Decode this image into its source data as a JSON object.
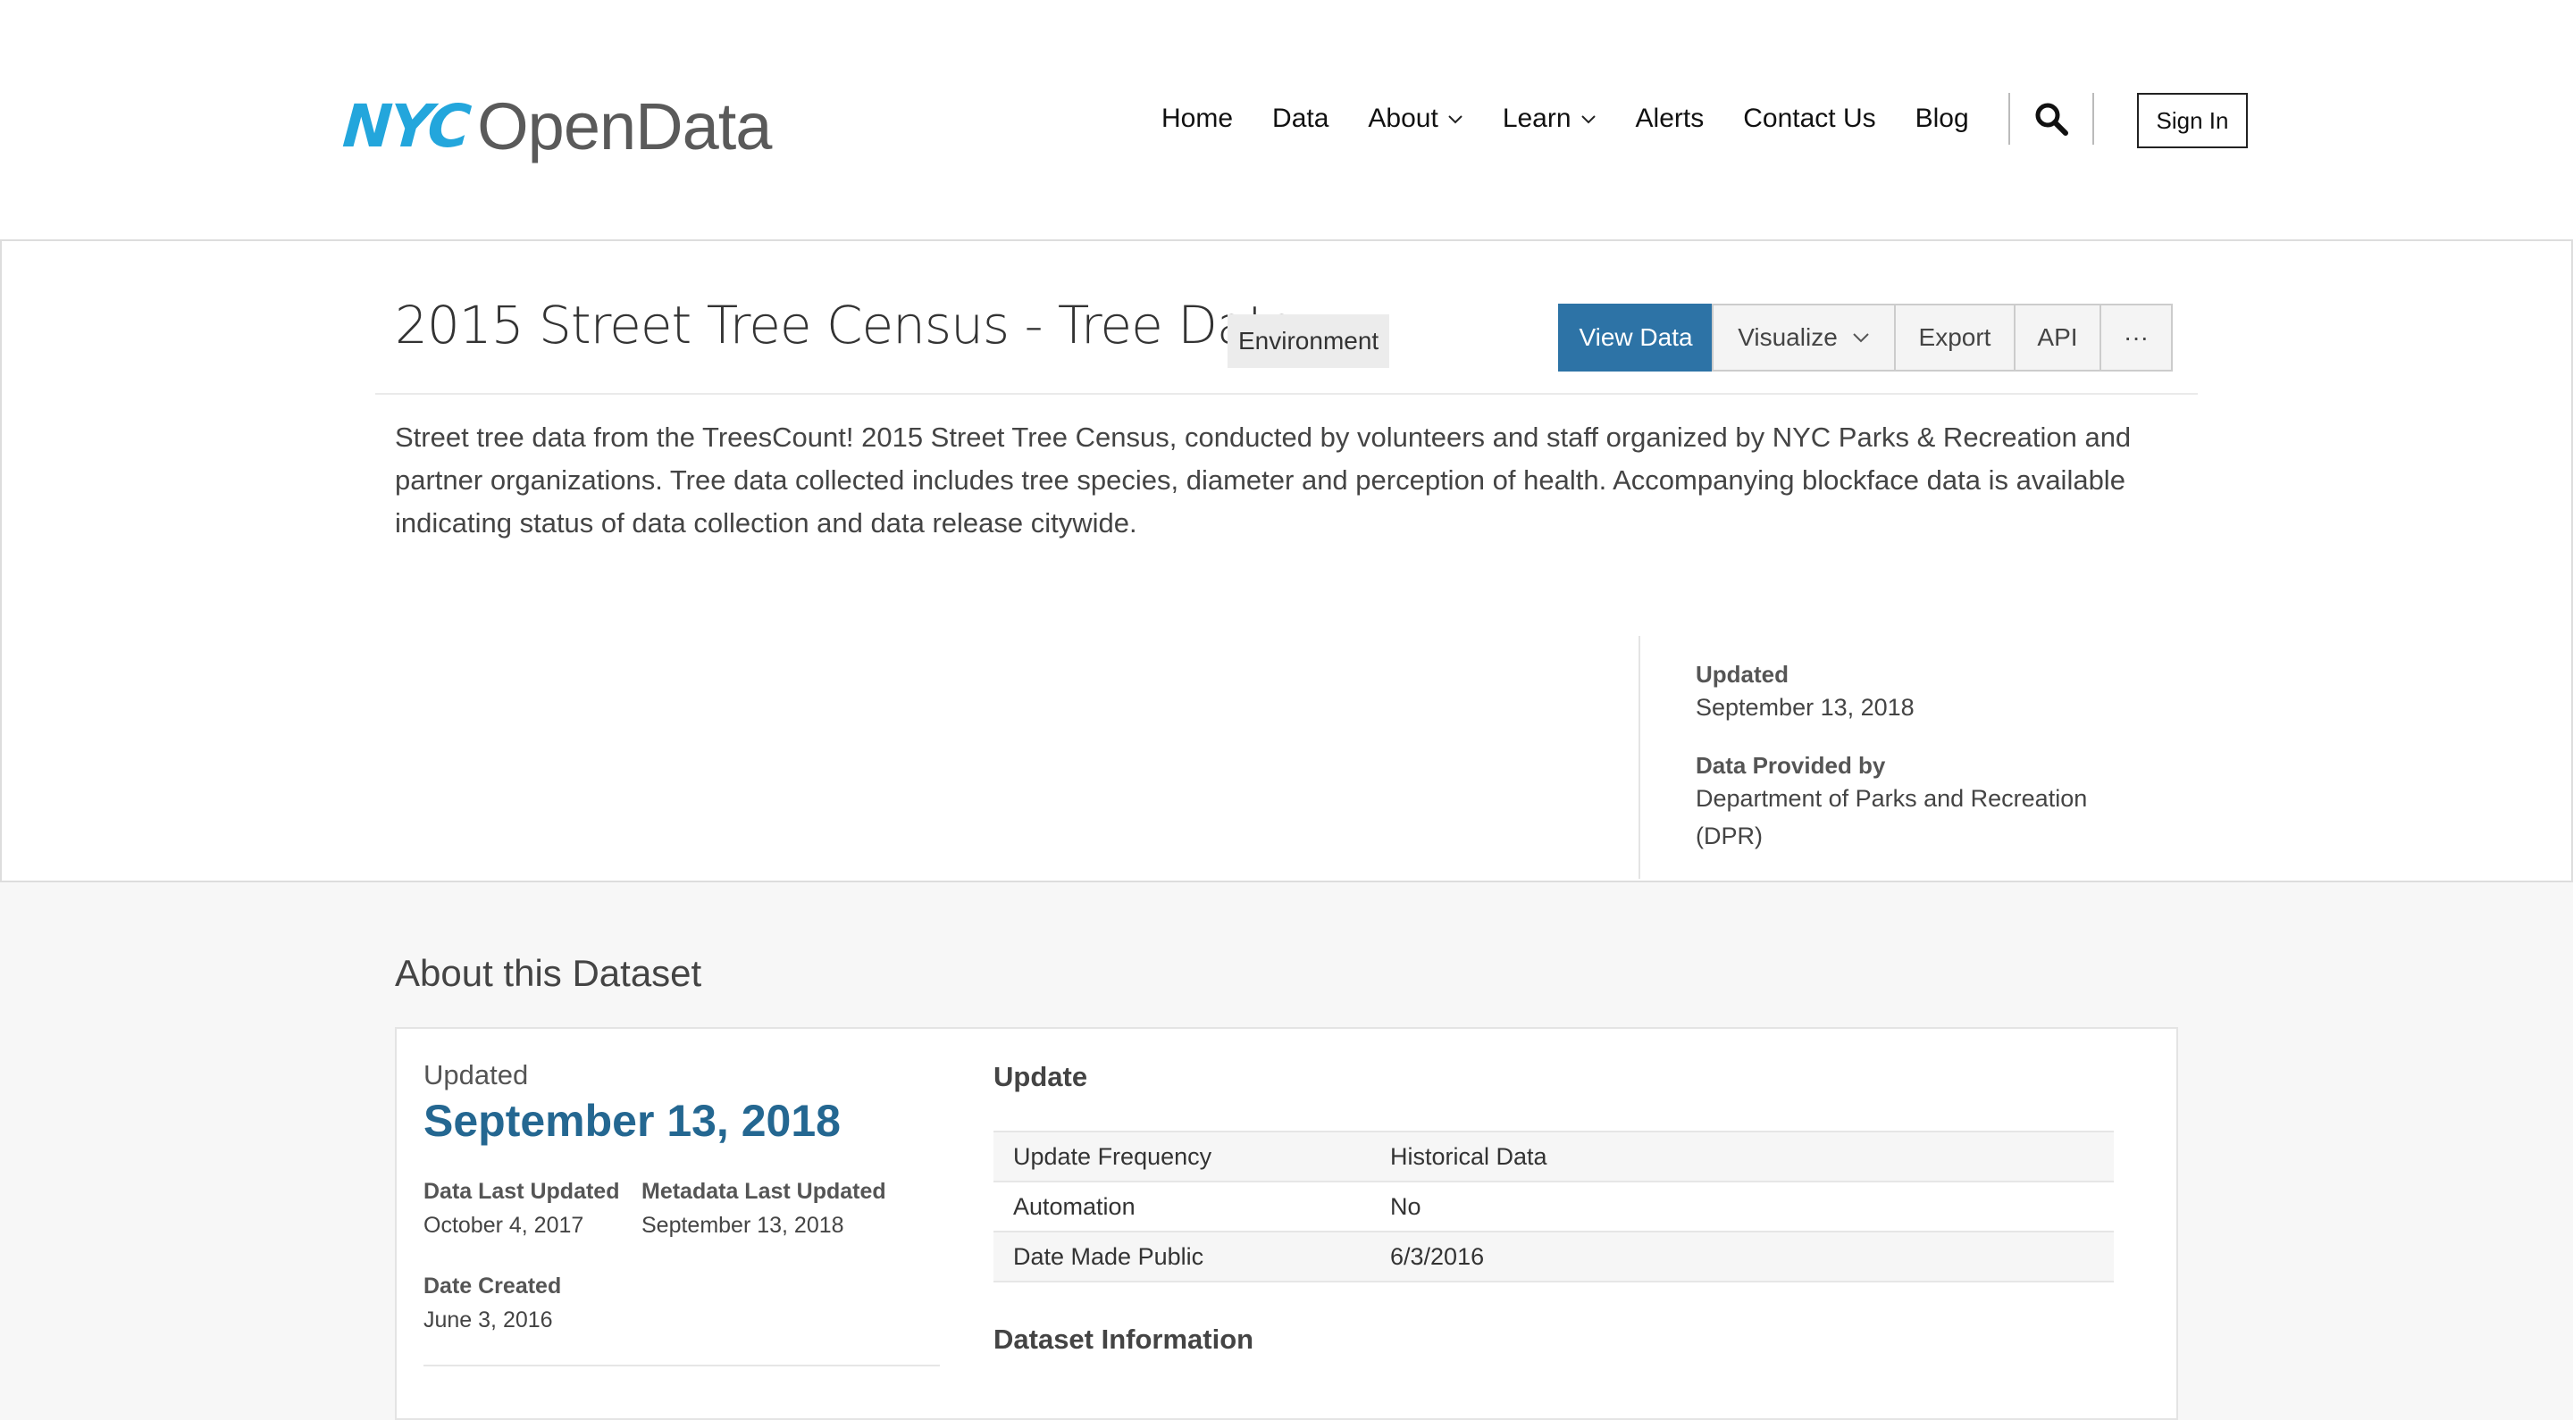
{
  "header": {
    "logo_nyc": "NYC",
    "logo_opendata": "OpenData",
    "nav": [
      {
        "label": "Home"
      },
      {
        "label": "Data"
      },
      {
        "label": "About"
      },
      {
        "label": "Learn"
      },
      {
        "label": "Alerts"
      },
      {
        "label": "Contact Us"
      },
      {
        "label": "Blog"
      }
    ],
    "sign_in": "Sign In"
  },
  "dataset": {
    "title": "2015 Street Tree Census - Tree Data",
    "category": "Environment",
    "actions": {
      "view_data": "View Data",
      "visualize": "Visualize",
      "export": "Export",
      "api": "API",
      "more": "···"
    },
    "description": "Street tree data from the TreesCount! 2015 Street Tree Census, conducted by volunteers and staff organized by NYC Parks & Recreation and partner organizations. Tree data collected includes tree species, diameter and perception of health. Accompanying blockface data is available indicating status of data collection and data release citywide.",
    "updated_label": "Updated",
    "updated_value": "September 13, 2018",
    "provided_label": "Data Provided by",
    "provided_value_line1": "Department of Parks and Recreation",
    "provided_value_line2": "(DPR)"
  },
  "about": {
    "title": "About this Dataset",
    "updated_label": "Updated",
    "updated_date": "September 13, 2018",
    "data_last_updated_label": "Data Last Updated",
    "data_last_updated_value": "October 4, 2017",
    "metadata_last_updated_label": "Metadata Last Updated",
    "metadata_last_updated_value": "September 13, 2018",
    "date_created_label": "Date Created",
    "date_created_value": "June 3, 2016",
    "update_section_title": "Update",
    "update_rows": [
      {
        "key": "Update Frequency",
        "value": "Historical Data"
      },
      {
        "key": "Automation",
        "value": "No"
      },
      {
        "key": "Date Made Public",
        "value": "6/3/2016"
      }
    ],
    "dataset_info_title": "Dataset Information"
  },
  "colors": {
    "brand_blue": "#23a6dc",
    "primary_button": "#2d73a6",
    "date_blue": "#246791"
  }
}
